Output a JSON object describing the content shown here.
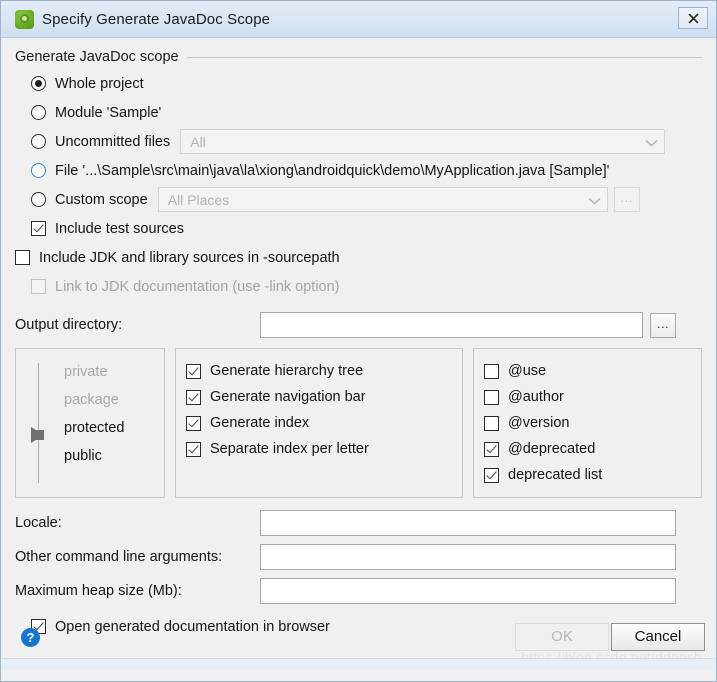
{
  "window": {
    "title": "Specify Generate JavaDoc Scope",
    "app_icon": "android-studio-icon",
    "close_label": "✕"
  },
  "scope_group": {
    "legend": "Generate JavaDoc scope",
    "options": [
      {
        "label": "Whole project",
        "mnemonic": "p",
        "selected": true
      },
      {
        "label": "Module 'Sample'",
        "mnemonic": "M",
        "selected": false
      },
      {
        "label": "Uncommitted files",
        "mnemonic": "U",
        "selected": false,
        "combo_value": "All",
        "combo_enabled": false
      },
      {
        "label": "File '...\\Sample\\src\\main\\java\\la\\xiong\\androidquick\\demo\\MyApplication.java [Sample]'",
        "mnemonic": "F",
        "selected": false,
        "focused": true
      },
      {
        "label": "Custom scope",
        "mnemonic": "C",
        "selected": false,
        "combo_value": "All Places",
        "combo_enabled": false,
        "dots_label": "..."
      }
    ]
  },
  "source_options": [
    {
      "label": "Include test sources",
      "checked": true,
      "enabled": true
    },
    {
      "label": "Include JDK and library sources in -sourcepath",
      "checked": false,
      "enabled": true
    },
    {
      "label": "Link to JDK documentation (use -link option)",
      "checked": false,
      "enabled": false
    }
  ],
  "output_directory": {
    "label": "Output directory:",
    "value": "",
    "placeholder": "",
    "browse_label": "..."
  },
  "visibility": {
    "levels": [
      "private",
      "package",
      "protected",
      "public"
    ],
    "selected": "protected",
    "dimmed": [
      "private",
      "package"
    ]
  },
  "generate_options": [
    {
      "label": "Generate hierarchy tree",
      "checked": true
    },
    {
      "label": "Generate navigation bar",
      "checked": true
    },
    {
      "label": "Generate index",
      "checked": true
    },
    {
      "label": "Separate index per letter",
      "checked": true
    }
  ],
  "tag_options": [
    {
      "label": "@use",
      "checked": false
    },
    {
      "label": "@author",
      "checked": false
    },
    {
      "label": "@version",
      "checked": false
    },
    {
      "label": "@deprecated",
      "checked": true
    },
    {
      "label": "deprecated list",
      "checked": true
    }
  ],
  "fields": [
    {
      "label": "Locale:",
      "value": "",
      "name": "locale"
    },
    {
      "label": "Other command line arguments:",
      "value": "",
      "name": "other-args"
    },
    {
      "label": "Maximum heap size (Mb):",
      "value": "",
      "name": "max-heap"
    }
  ],
  "open_in_browser": {
    "label": "Open generated documentation in browser",
    "checked": true
  },
  "footer": {
    "help_label": "?",
    "ok_label": "OK",
    "ok_enabled": false,
    "cancel_label": "Cancel",
    "watermark": "https://blog.csdn.net/ddnosh"
  },
  "colors": {
    "dialog_bg": "#f0f0f0",
    "titlebar": "#dbe7f4",
    "accent_blue": "#1576d0",
    "focus_ring": "#2f7fd0",
    "icon_green": "#62a824"
  }
}
